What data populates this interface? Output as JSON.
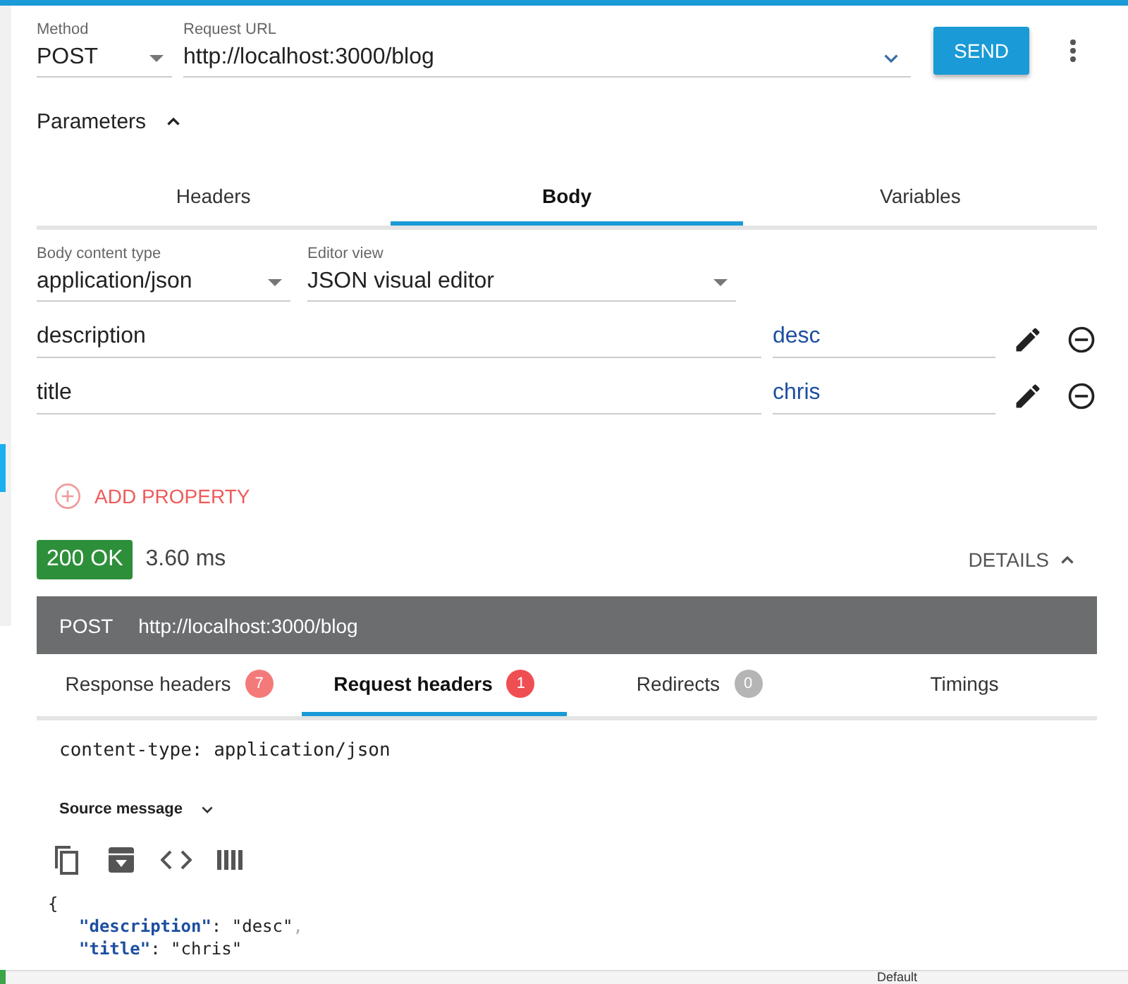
{
  "request": {
    "method_label": "Method",
    "method": "POST",
    "url_label": "Request URL",
    "url": "http://localhost:3000/blog",
    "send": "SEND"
  },
  "parameters": {
    "title": "Parameters",
    "expanded": true
  },
  "tabs": [
    {
      "label": "Headers",
      "selected": false
    },
    {
      "label": "Body",
      "selected": true
    },
    {
      "label": "Variables",
      "selected": false
    }
  ],
  "body": {
    "content_type_label": "Body content type",
    "content_type": "application/json",
    "editor_view_label": "Editor view",
    "editor_view": "JSON visual editor",
    "properties": [
      {
        "name": "description",
        "value": "desc"
      },
      {
        "name": "title",
        "value": "chris"
      }
    ],
    "add_property": "ADD PROPERTY"
  },
  "response": {
    "status": "200 OK",
    "time": "3.60 ms",
    "details": "DETAILS",
    "details_expanded": true,
    "method": "POST",
    "url": "http://localhost:3000/blog",
    "tabs": [
      {
        "label": "Response headers",
        "count": "7",
        "color": "#f47a7a",
        "selected": false
      },
      {
        "label": "Request headers",
        "count": "1",
        "color": "#ef4f52",
        "selected": true
      },
      {
        "label": "Redirects",
        "count": "0",
        "color": "#b5b5b5",
        "selected": false
      },
      {
        "label": "Timings",
        "selected": false
      }
    ],
    "headers_text": "content-type: application/json",
    "source_label": "Source message",
    "source_lines": [
      [
        {
          "text": "{",
          "kind": "punct"
        }
      ],
      [
        {
          "text": "\"description\"",
          "kind": "key"
        },
        {
          "text": ": ",
          "kind": "punct"
        },
        {
          "text": "\"desc\"",
          "kind": "string"
        },
        {
          "text": ",",
          "kind": "comma"
        }
      ],
      [
        {
          "text": "\"title\"",
          "kind": "key"
        },
        {
          "text": ": ",
          "kind": "punct"
        },
        {
          "text": "\"chris\"",
          "kind": "string"
        }
      ]
    ]
  },
  "status_bar": {
    "text": "Default"
  }
}
